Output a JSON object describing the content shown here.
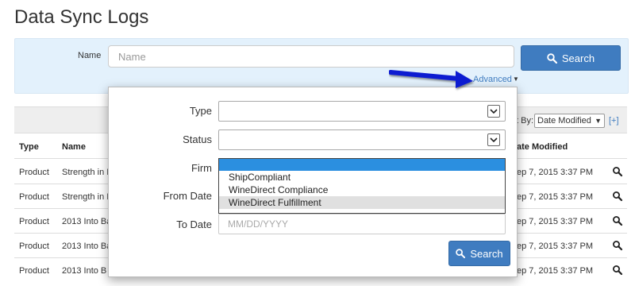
{
  "page": {
    "title": "Data Sync Logs"
  },
  "search": {
    "name_label": "Name",
    "name_placeholder": "Name",
    "search_button": "Search",
    "advanced_link": "Advanced"
  },
  "table": {
    "sort_label": "t By:",
    "sort_value": "Date Modified",
    "add_column": "[+]",
    "headers": {
      "type": "Type",
      "name": "Name",
      "date": "ate Modified"
    },
    "rows": [
      {
        "type": "Product",
        "name": "Strength in I",
        "date": "ep 7, 2015 3:37 PM"
      },
      {
        "type": "Product",
        "name": "Strength in I",
        "date": "ep 7, 2015 3:37 PM"
      },
      {
        "type": "Product",
        "name": "2013 Into Ba",
        "date": "ep 7, 2015 3:37 PM"
      },
      {
        "type": "Product",
        "name": "2013 Into Ba",
        "date": "ep 7, 2015 3:37 PM"
      },
      {
        "type": "Product",
        "name": "2013 Into B",
        "date": "ep 7, 2015 3:37 PM"
      }
    ]
  },
  "advanced": {
    "type_label": "Type",
    "status_label": "Status",
    "firm_label": "Firm",
    "firm_options": [
      "",
      "ShipCompliant",
      "WineDirect Compliance",
      "WineDirect Fulfillment"
    ],
    "from_date_label": "From Date",
    "to_date_label": "To Date",
    "to_date_placeholder": "MM/DD/YYYY",
    "search_button": "Search"
  },
  "colors": {
    "accent": "#3f7cc0",
    "panel": "#e3f1fc",
    "selected_option": "#2b8fe0",
    "arrow": "#0d1fd1"
  },
  "icons": [
    "search-icon",
    "magnifier-icon",
    "chevron-down-icon",
    "arrow-annotation"
  ]
}
